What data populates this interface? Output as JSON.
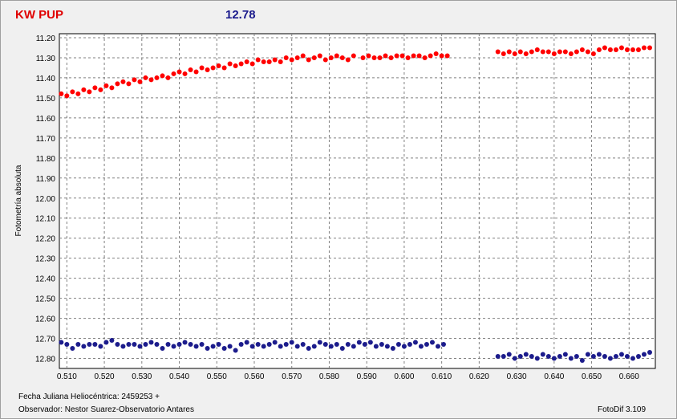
{
  "header": {
    "star_name": "KW PUP",
    "comparison_mag": "12.78"
  },
  "footer": {
    "date_label": "Fecha Juliana Heliocéntrica: 2459253 +",
    "observer": "Observador: Nestor Suarez-Observatorio Antares",
    "software": "FotoDif 3.109"
  },
  "colors": {
    "variable": "#ff0000",
    "comparison": "#1c1c8c",
    "grid": "#808080",
    "plot_bg": "#ffffff"
  },
  "chart_data": {
    "type": "scatter",
    "title": "",
    "xlabel": "",
    "ylabel": "Fotometría absoluta",
    "xlim": [
      0.508,
      0.667
    ],
    "ylim": [
      11.18,
      12.85
    ],
    "y_inverted": true,
    "grid": true,
    "x_ticks": [
      "0.510",
      "0.520",
      "0.530",
      "0.540",
      "0.550",
      "0.560",
      "0.570",
      "0.580",
      "0.590",
      "0.600",
      "0.610",
      "0.620",
      "0.630",
      "0.640",
      "0.650",
      "0.660"
    ],
    "y_ticks": [
      "11.20",
      "11.30",
      "11.40",
      "11.50",
      "11.60",
      "11.70",
      "11.80",
      "11.90",
      "12.00",
      "12.10",
      "12.20",
      "12.30",
      "12.40",
      "12.50",
      "12.60",
      "12.70",
      "12.80"
    ],
    "series": [
      {
        "color": "#ff0000",
        "x": [
          0.5085,
          0.51,
          0.5115,
          0.513,
          0.5145,
          0.516,
          0.5175,
          0.519,
          0.5205,
          0.522,
          0.5235,
          0.525,
          0.5265,
          0.528,
          0.5295,
          0.531,
          0.5325,
          0.534,
          0.5355,
          0.537,
          0.5385,
          0.54,
          0.5415,
          0.543,
          0.5445,
          0.546,
          0.5475,
          0.549,
          0.5505,
          0.552,
          0.5535,
          0.555,
          0.5565,
          0.558,
          0.5595,
          0.561,
          0.5625,
          0.564,
          0.5655,
          0.567,
          0.5685,
          0.57,
          0.5715,
          0.573,
          0.5745,
          0.576,
          0.5775,
          0.579,
          0.5805,
          0.582,
          0.5835,
          0.585,
          0.5865,
          0.589,
          0.5905,
          0.592,
          0.5935,
          0.595,
          0.5965,
          0.598,
          0.5995,
          0.601,
          0.6025,
          0.604,
          0.6055,
          0.607,
          0.6085,
          0.61,
          0.6115,
          0.625,
          0.6265,
          0.628,
          0.6295,
          0.631,
          0.6325,
          0.634,
          0.6355,
          0.637,
          0.6385,
          0.64,
          0.6415,
          0.643,
          0.6445,
          0.646,
          0.6475,
          0.649,
          0.6505,
          0.652,
          0.6535,
          0.655,
          0.6565,
          0.658,
          0.6595,
          0.661,
          0.6625,
          0.664,
          0.6655
        ],
        "y": [
          11.48,
          11.49,
          11.47,
          11.48,
          11.46,
          11.47,
          11.45,
          11.46,
          11.44,
          11.45,
          11.43,
          11.42,
          11.43,
          11.41,
          11.42,
          11.4,
          11.41,
          11.4,
          11.39,
          11.4,
          11.38,
          11.37,
          11.38,
          11.36,
          11.37,
          11.35,
          11.36,
          11.35,
          11.34,
          11.35,
          11.33,
          11.34,
          11.33,
          11.32,
          11.33,
          11.31,
          11.32,
          11.32,
          11.31,
          11.32,
          11.3,
          11.31,
          11.3,
          11.29,
          11.31,
          11.3,
          11.29,
          11.31,
          11.3,
          11.29,
          11.3,
          11.31,
          11.29,
          11.3,
          11.29,
          11.3,
          11.3,
          11.29,
          11.3,
          11.29,
          11.29,
          11.3,
          11.29,
          11.29,
          11.3,
          11.29,
          11.28,
          11.29,
          11.29,
          11.27,
          11.28,
          11.27,
          11.28,
          11.27,
          11.28,
          11.27,
          11.26,
          11.27,
          11.27,
          11.28,
          11.27,
          11.27,
          11.28,
          11.27,
          11.26,
          11.27,
          11.28,
          11.26,
          11.25,
          11.26,
          11.26,
          11.25,
          11.26,
          11.26,
          11.26,
          11.25,
          11.25
        ]
      },
      {
        "color": "#1c1c8c",
        "x": [
          0.5085,
          0.51,
          0.5115,
          0.513,
          0.5145,
          0.516,
          0.5175,
          0.519,
          0.5205,
          0.522,
          0.5235,
          0.525,
          0.5265,
          0.528,
          0.5295,
          0.531,
          0.5325,
          0.534,
          0.5355,
          0.537,
          0.5385,
          0.54,
          0.5415,
          0.543,
          0.5445,
          0.546,
          0.5475,
          0.549,
          0.5505,
          0.552,
          0.5535,
          0.555,
          0.5565,
          0.558,
          0.5595,
          0.561,
          0.5625,
          0.564,
          0.5655,
          0.567,
          0.5685,
          0.57,
          0.5715,
          0.573,
          0.5745,
          0.576,
          0.5775,
          0.579,
          0.5805,
          0.582,
          0.5835,
          0.585,
          0.5865,
          0.588,
          0.5895,
          0.591,
          0.5925,
          0.594,
          0.5955,
          0.597,
          0.5985,
          0.6,
          0.6015,
          0.603,
          0.6045,
          0.606,
          0.6075,
          0.609,
          0.6105,
          0.625,
          0.6265,
          0.628,
          0.6295,
          0.631,
          0.6325,
          0.634,
          0.6355,
          0.637,
          0.6385,
          0.64,
          0.6415,
          0.643,
          0.6445,
          0.646,
          0.6475,
          0.649,
          0.6505,
          0.652,
          0.6535,
          0.655,
          0.6565,
          0.658,
          0.6595,
          0.661,
          0.6625,
          0.664,
          0.6655
        ],
        "y": [
          12.72,
          12.73,
          12.75,
          12.73,
          12.74,
          12.73,
          12.73,
          12.74,
          12.72,
          12.71,
          12.73,
          12.74,
          12.73,
          12.73,
          12.74,
          12.73,
          12.72,
          12.73,
          12.75,
          12.73,
          12.74,
          12.73,
          12.72,
          12.73,
          12.74,
          12.73,
          12.75,
          12.74,
          12.73,
          12.75,
          12.74,
          12.76,
          12.73,
          12.72,
          12.74,
          12.73,
          12.74,
          12.73,
          12.72,
          12.74,
          12.73,
          12.72,
          12.74,
          12.73,
          12.75,
          12.74,
          12.72,
          12.73,
          12.74,
          12.73,
          12.75,
          12.73,
          12.74,
          12.72,
          12.73,
          12.72,
          12.74,
          12.73,
          12.74,
          12.75,
          12.73,
          12.74,
          12.73,
          12.72,
          12.74,
          12.73,
          12.72,
          12.74,
          12.73,
          12.79,
          12.79,
          12.78,
          12.8,
          12.79,
          12.78,
          12.79,
          12.8,
          12.78,
          12.79,
          12.8,
          12.79,
          12.78,
          12.8,
          12.79,
          12.81,
          12.78,
          12.79,
          12.78,
          12.79,
          12.8,
          12.79,
          12.78,
          12.79,
          12.8,
          12.79,
          12.78,
          12.77
        ]
      }
    ]
  }
}
